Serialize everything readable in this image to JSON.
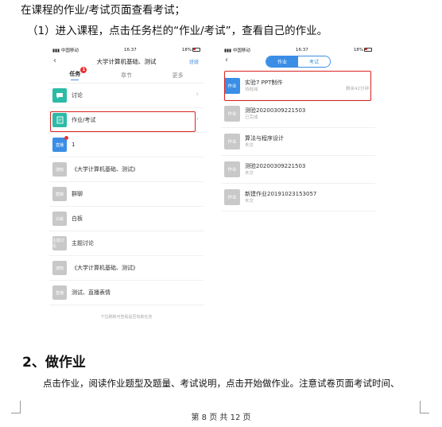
{
  "doc": {
    "intro": "在课程的作业/考试页面查看考试；",
    "step1": "（1）进入课程，点击任务栏的“作业/考试”，查看自己的作业。",
    "heading2": "2、做作业",
    "para": "点击作业，阅读作业题型及题量、考试说明，点击开始做作业。注意试卷页面考试时间、",
    "page_number": "第 8 页 共 12 页"
  },
  "left_phone": {
    "carrier": "中国移动",
    "time": "16:37",
    "battery": "18%",
    "title": "大学计算机基础、测试",
    "nav_right": "班级",
    "tabs": [
      "任务",
      "章节",
      "更多"
    ],
    "task_badge": "1",
    "items": [
      {
        "icon": "讨论",
        "label": "讨论"
      },
      {
        "icon": "作业",
        "label": "作业/考试"
      },
      {
        "icon": "直播",
        "label": "1"
      },
      {
        "icon": "通知",
        "label": "《大学计算机基础、测试》"
      },
      {
        "icon": "群聊",
        "label": "群聊"
      },
      {
        "icon": "白板",
        "label": "白板"
      },
      {
        "icon": "主题讨论",
        "label": "主题讨论"
      },
      {
        "icon": "通知",
        "label": "《大学计算机基础、测试》"
      },
      {
        "icon": "直播",
        "label": "测试、直播表情"
      }
    ],
    "footer_hint": "下拉刷新可查看是否有新任务"
  },
  "right_phone": {
    "carrier": "中国移动",
    "time": "16:37",
    "battery": "18%",
    "seg_homework": "作业",
    "seg_exam": "考试",
    "homework_icon": "作业",
    "items": [
      {
        "title": "实验7 PPT制作",
        "status": "待批阅",
        "right": "剩余42分钟"
      },
      {
        "title": "测验20200309221503",
        "status": "已完成",
        "right": ""
      },
      {
        "title": "算法与程序设计",
        "status": "未交",
        "right": ""
      },
      {
        "title": "测验20200309221503",
        "status": "未交",
        "right": ""
      },
      {
        "title": "新建作业20191023153057",
        "status": "未交",
        "right": ""
      }
    ]
  },
  "colors": {
    "accent": "#3a8ee6",
    "highlight": "#d9231f",
    "teal": "#2bbba6"
  }
}
